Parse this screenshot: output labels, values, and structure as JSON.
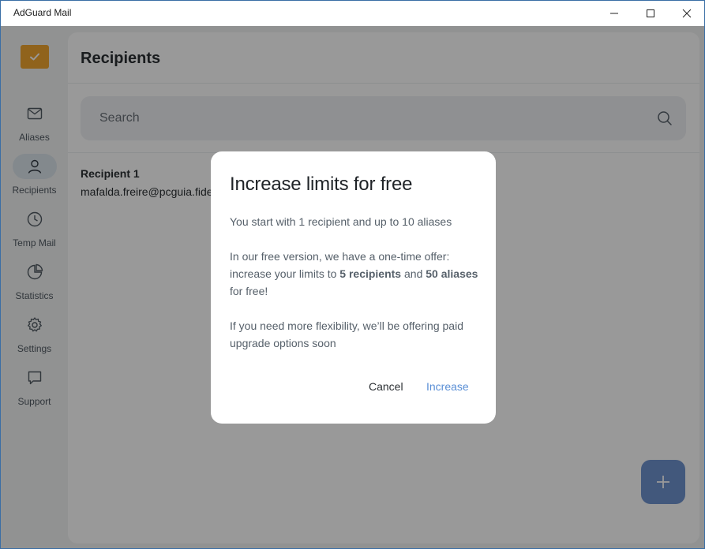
{
  "window": {
    "title": "AdGuard Mail"
  },
  "sidebar": {
    "items": [
      {
        "label": "Aliases",
        "icon": "mail-icon",
        "active": false
      },
      {
        "label": "Recipients",
        "icon": "user-icon",
        "active": true
      },
      {
        "label": "Temp Mail",
        "icon": "clock-icon",
        "active": false
      },
      {
        "label": "Statistics",
        "icon": "pie-chart-icon",
        "active": false
      },
      {
        "label": "Settings",
        "icon": "gear-icon",
        "active": false
      },
      {
        "label": "Support",
        "icon": "chat-icon",
        "active": false
      }
    ]
  },
  "main": {
    "title": "Recipients",
    "search": {
      "placeholder": "Search"
    },
    "recipients": [
      {
        "name": "Recipient 1",
        "email": "mafalda.freire@pcguia.fide"
      }
    ]
  },
  "dialog": {
    "title": "Increase limits for free",
    "p1": "You start with 1 recipient and up to 10 aliases",
    "p2_a": "In our free version, we have a one-time offer: increase your limits to ",
    "p2_b1": "5 recipients",
    "p2_c": " and ",
    "p2_b2": "50 aliases",
    "p2_d": " for free!",
    "p3": "If you need more flexibility, we’ll be offering paid upgrade options soon",
    "cancel": "Cancel",
    "increase": "Increase"
  },
  "colors": {
    "accent": "#5a8fd6",
    "fab": "#6f93cf",
    "logo": "#f0a630",
    "active_nav_bg": "#dbe4ec"
  }
}
